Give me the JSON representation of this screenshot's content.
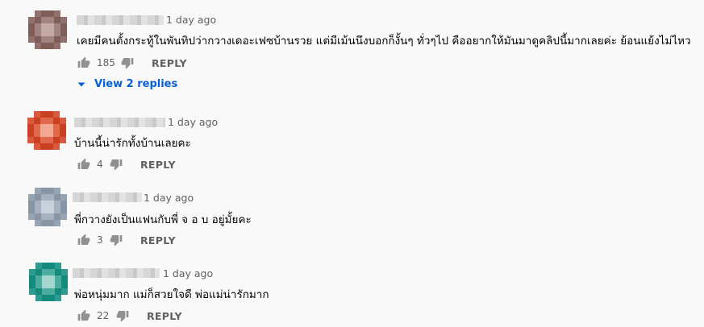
{
  "comments": [
    {
      "time": "1 day ago",
      "text": "เคยมีคนตั้งกระทู้ในพันทิปว่ากวางเดอะเฟซบ้านรวย แต่มีเม้นนึงบอกก็งั้นๆ ทั่วๆไป คืออยากให้มันมาดูคลิปนี้มากเลยค่ะ ย้อนแย้งไม่ไหว",
      "likes": "185",
      "reply_label": "REPLY",
      "avatar_palette": [
        "#7f5d58",
        "#a2847f",
        "#c3aaa4",
        "#8f706b"
      ]
    },
    {
      "time": "1 day ago",
      "text": "บ้านนี้น่ารักทั้งบ้านเลยคะ",
      "likes": "4",
      "reply_label": "REPLY",
      "avatar_palette": [
        "#cc4022",
        "#e0694c",
        "#f0a892",
        "#d85a3e"
      ]
    },
    {
      "time": "1 day ago",
      "text": "พี่กวางยังเป็นแฟนกับพี่ จ อ บ อยู่มั้ยคะ",
      "likes": "3",
      "reply_label": "REPLY",
      "avatar_palette": [
        "#8795a4",
        "#a6b2bf",
        "#c9d1da",
        "#96a3b1"
      ]
    },
    {
      "time": "1 day ago",
      "text": "พ่อหนุ่มมาก แม่ก็สวยใจดี พ่อแม่น่ารักมาก",
      "likes": "22",
      "reply_label": "REPLY",
      "avatar_palette": [
        "#138a7c",
        "#4bab9f",
        "#a3d6cf",
        "#2d9b8e"
      ]
    }
  ],
  "view_replies_label": "View 2 replies",
  "colors": {
    "link": "#065fd4",
    "secondary_text": "#606060",
    "icon": "#909090"
  }
}
